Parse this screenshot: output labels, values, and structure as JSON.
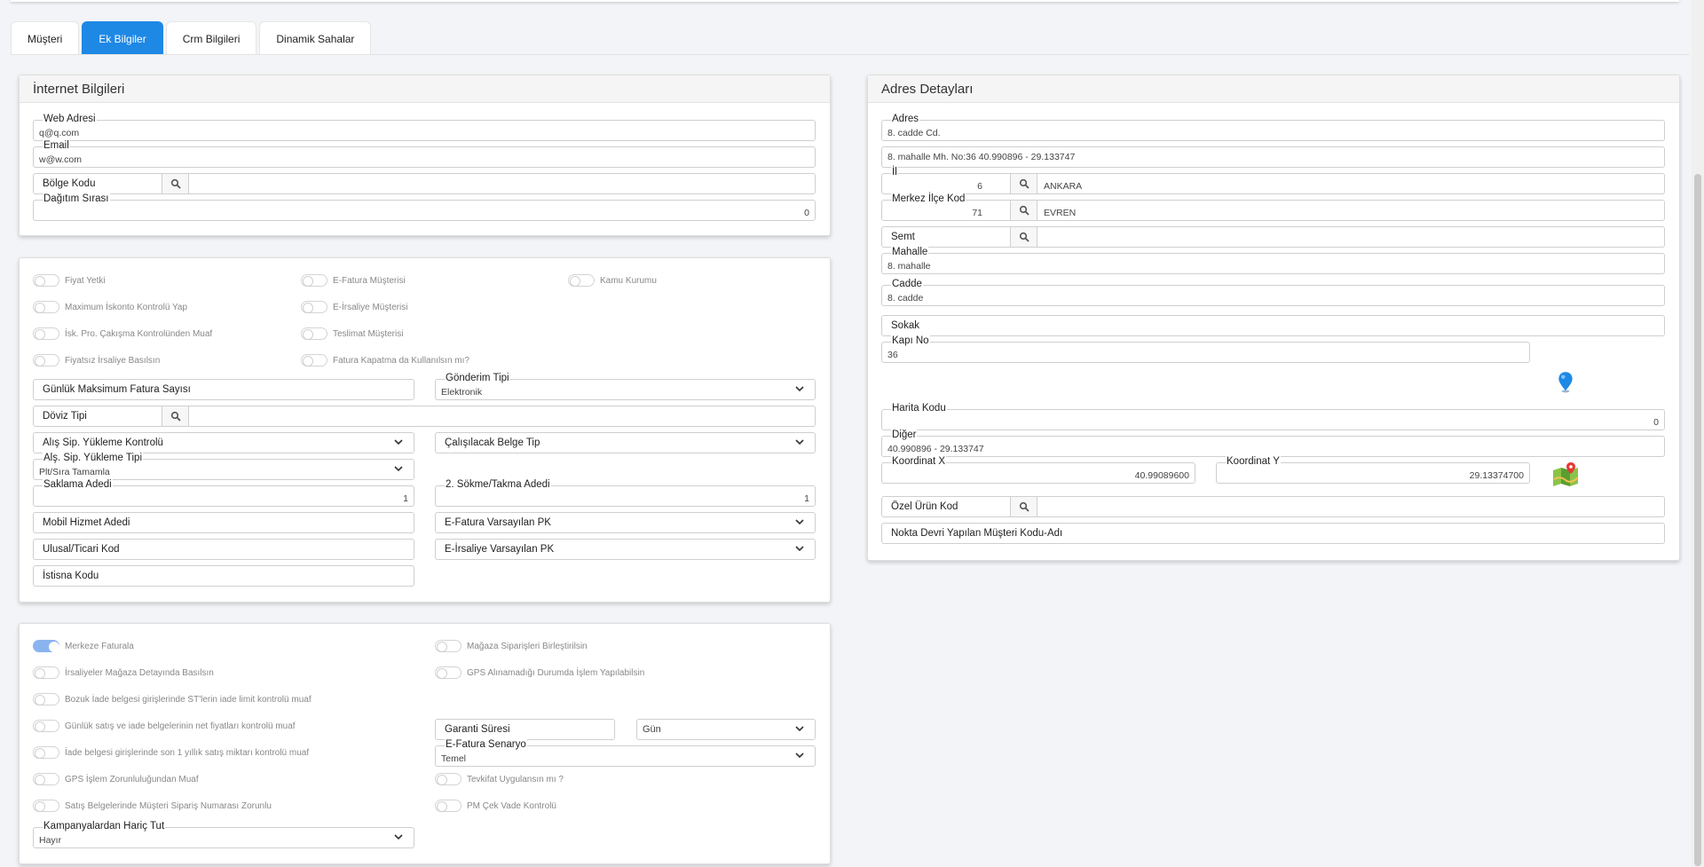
{
  "tabs": [
    {
      "label": "Müşteri",
      "active": false
    },
    {
      "label": "Ek Bilgiler",
      "active": true
    },
    {
      "label": "Crm Bilgileri",
      "active": false
    },
    {
      "label": "Dinamik Sahalar",
      "active": false
    }
  ],
  "internet": {
    "title": "İnternet Bilgileri",
    "web_label": "Web Adresi",
    "web_value": "q@q.com",
    "email_label": "Email",
    "email_value": "w@w.com",
    "bolge_label": "Bölge Kodu",
    "dagitim_label": "Dağıtım Sırası",
    "dagitim_value": "0"
  },
  "options": {
    "toggles": [
      {
        "label": "Fiyat Yetki",
        "on": false
      },
      {
        "label": "Maximum İskonto Kontrolü Yap",
        "on": false
      },
      {
        "label": "İsk. Pro. Çakışma Kontrolünden Muaf",
        "on": false
      },
      {
        "label": "Fiyatsız İrsaliye Basılsın",
        "on": false
      },
      {
        "label": "E-Fatura Müşterisi",
        "on": false
      },
      {
        "label": "E-İrsaliye Müşterisi",
        "on": false
      },
      {
        "label": "Teslimat Müşterisi",
        "on": false
      },
      {
        "label": "Fatura Kapatma da Kullanılsın mı?",
        "on": false
      },
      {
        "label": "Kamu Kurumu",
        "on": false
      }
    ],
    "gunluk_label": "Günlük Maksimum Fatura Sayısı",
    "gonderim_label": "Gönderim Tipi",
    "gonderim_value": "Elektronik",
    "doviz_label": "Döviz Tipi",
    "alis_kontrol_label": "Alış Sip. Yükleme Kontrolü",
    "calisilacak_label": "Çalışılacak Belge Tip",
    "alis_tipi_label": "Alş. Sip. Yükleme Tipi",
    "alis_tipi_value": "Plt/Sıra Tamamla",
    "saklama_label": "Saklama Adedi",
    "saklama_value": "1",
    "sokme_label": "2. Sökme/Takma Adedi",
    "sokme_value": "1",
    "mobil_label": "Mobil Hizmet Adedi",
    "efatura_pk_label": "E-Fatura Varsayılan PK",
    "ulusal_label": "Ulusal/Ticari Kod",
    "eirsaliye_pk_label": "E-İrsaliye Varsayılan PK",
    "istisna_label": "İstisna Kodu"
  },
  "merkez": {
    "toggles_left": [
      {
        "label": "Merkeze Faturala",
        "on": true
      },
      {
        "label": "İrsaliyeler Mağaza Detayında Basılsın",
        "on": false
      },
      {
        "label": "Bozuk İade belgesi girişlerinde ST'lerin iade limit kontrolü muaf",
        "on": false
      },
      {
        "label": "Günlük satış ve iade belgelerinin net fiyatları kontrolü muaf",
        "on": false
      },
      {
        "label": "İade belgesi girişlerinde son 1 yıllık satış miktarı kontrolü muaf",
        "on": false
      },
      {
        "label": "GPS İşlem Zorunluluğundan Muaf",
        "on": false
      },
      {
        "label": "Satış Belgelerinde Müşteri Sipariş Numarası Zorunlu",
        "on": false
      }
    ],
    "toggles_right": [
      {
        "label": "Mağaza Siparişleri Birleştirilsin",
        "on": false
      },
      {
        "label": "GPS Alınamadığı Durumda İşlem Yapılabilsin",
        "on": false
      },
      {
        "label": "Tevkifat Uygulansın mı ?",
        "on": false
      },
      {
        "label": "PM Çek Vade Kontrolü",
        "on": false
      }
    ],
    "garanti_label": "Garanti Süresi",
    "garanti_unit": "Gün",
    "senaryo_label": "E-Fatura Senaryo",
    "senaryo_value": "Temel",
    "kampanya_label": "Kampanyalardan Hariç Tut",
    "kampanya_value": "Hayır"
  },
  "adres": {
    "title": "Adres Detayları",
    "adres_label": "Adres",
    "adres_value": "8. cadde  Cd.",
    "adres2_value": "8. mahalle Mh.  No:36 40.990896 - 29.133747",
    "il_label": "İl",
    "il_code": "6",
    "il_name": "ANKARA",
    "ilce_label": "Merkez İlçe Kod",
    "ilce_code": "71",
    "ilce_name": "EVREN",
    "semt_label": "Semt",
    "mahalle_label": "Mahalle",
    "mahalle_value": "8. mahalle",
    "cadde_label": "Cadde",
    "cadde_value": "8. cadde",
    "sokak_label": "Sokak",
    "kapi_label": "Kapı No",
    "kapi_value": "36",
    "harita_label": "Harita Kodu",
    "harita_value": "0",
    "diger_label": "Diğer",
    "diger_value": "40.990896 - 29.133747",
    "kx_label": "Koordinat X",
    "kx_value": "40.99089600",
    "ky_label": "Koordinat Y",
    "ky_value": "29.13374700",
    "ozel_label": "Özel Ürün Kod",
    "nokta_label": "Nokta Devri Yapılan Müşteri Kodu-Adı"
  },
  "colors": {
    "accent": "#1e88e5",
    "toggle_on": "#8ab4f0"
  }
}
